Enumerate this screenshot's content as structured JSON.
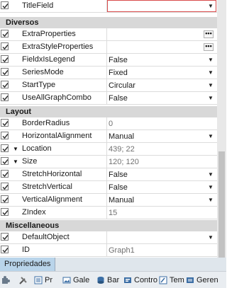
{
  "rows": {
    "titlefield": {
      "name": "TitleField",
      "value": ""
    },
    "diversos": "Diversos",
    "extraproperties": {
      "name": "ExtraProperties",
      "value": ""
    },
    "extrastyleproperties": {
      "name": "ExtraStyleProperties",
      "value": ""
    },
    "fieldxislegend": {
      "name": "FieldxIsLegend",
      "value": "False"
    },
    "seriesmode": {
      "name": "SeriesMode",
      "value": "Fixed"
    },
    "starttype": {
      "name": "StartType",
      "value": "Circular"
    },
    "useallgraphcombo": {
      "name": "UseAllGraphCombo",
      "value": "False"
    },
    "layout": "Layout",
    "borderradius": {
      "name": "BorderRadius",
      "value": "0"
    },
    "horizontalalignment": {
      "name": "HorizontalAlignment",
      "value": "Manual"
    },
    "location": {
      "name": "Location",
      "value": "439; 22"
    },
    "size": {
      "name": "Size",
      "value": "120; 120"
    },
    "stretchhorizontal": {
      "name": "StretchHorizontal",
      "value": "False"
    },
    "stretchvertical": {
      "name": "StretchVertical",
      "value": "False"
    },
    "verticalalignment": {
      "name": "VerticalAlignment",
      "value": "Manual"
    },
    "zindex": {
      "name": "ZIndex",
      "value": "15"
    },
    "miscellaneous": "Miscellaneous",
    "defaultobject": {
      "name": "DefaultObject",
      "value": ""
    },
    "id": {
      "name": "ID",
      "value": "Graph1"
    }
  },
  "ellipsis": "•••",
  "tabs": {
    "active": "Propriedades"
  },
  "toolbar": {
    "item1": "",
    "item2": "Pr",
    "item3": "Gale",
    "item4": "Bar",
    "item5": "Contro",
    "item6": "Tem",
    "item7": "Geren"
  }
}
